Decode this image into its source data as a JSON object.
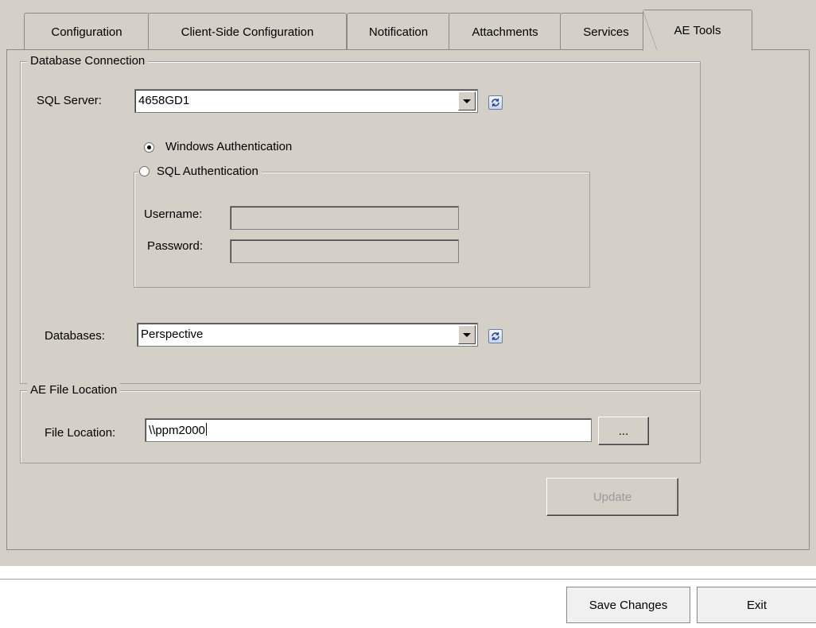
{
  "tabs": [
    {
      "label": "Configuration",
      "active": false
    },
    {
      "label": "Client-Side Configuration",
      "active": false
    },
    {
      "label": "Notification",
      "active": false
    },
    {
      "label": "Attachments",
      "active": false
    },
    {
      "label": "Services",
      "active": false
    },
    {
      "label": "AE Tools",
      "active": true
    }
  ],
  "database_connection": {
    "legend": "Database Connection",
    "sql_server_label": "SQL Server:",
    "sql_server_value": "4658GD1",
    "windows_auth_label": "Windows Authentication",
    "windows_auth_selected": true,
    "sql_auth_label": "SQL Authentication",
    "sql_auth_selected": false,
    "username_label": "Username:",
    "username_value": "",
    "password_label": "Password:",
    "password_value": "",
    "databases_label": "Databases:",
    "databases_value": "Perspective"
  },
  "ae_file_location": {
    "legend": "AE File Location",
    "file_location_label": "File Location:",
    "file_location_value": "\\\\ppm2000",
    "browse_label": "..."
  },
  "update_label": "Update",
  "footer": {
    "save_label": "Save Changes",
    "exit_label": "Exit"
  },
  "icons": {
    "refresh": "refresh-icon",
    "dropdown": "chevron-down-icon"
  }
}
